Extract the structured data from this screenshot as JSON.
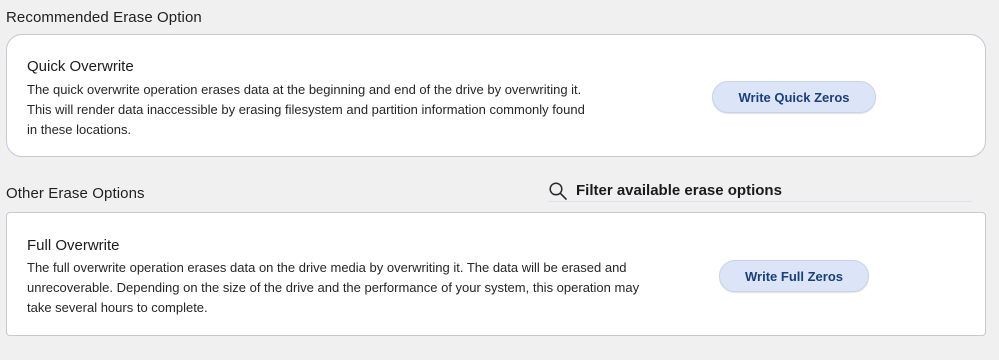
{
  "recommended": {
    "section_label": "Recommended Erase Option",
    "card": {
      "title": "Quick Overwrite",
      "description": "The quick overwrite operation erases data at the beginning and end of the drive by overwriting it. This will render data inaccessible by erasing filesystem and partition information commonly found in these locations.",
      "button_label": "Write Quick Zeros"
    }
  },
  "other": {
    "section_label": "Other Erase Options",
    "filter": {
      "text": "Filter available erase options",
      "icon": "search-icon"
    },
    "card": {
      "title": "Full Overwrite",
      "description": "The full overwrite operation erases data on the drive media by overwriting it. The data will be erased and unrecoverable. Depending on the size of the drive and the performance of your system, this operation may take several hours to complete.",
      "button_label": "Write Full Zeros"
    }
  },
  "colors": {
    "background": "#f0f0f0",
    "card_background": "#ffffff",
    "card_border": "#c9c7d6",
    "button_background": "#dbe5f7",
    "button_text": "#1c3f7a"
  }
}
